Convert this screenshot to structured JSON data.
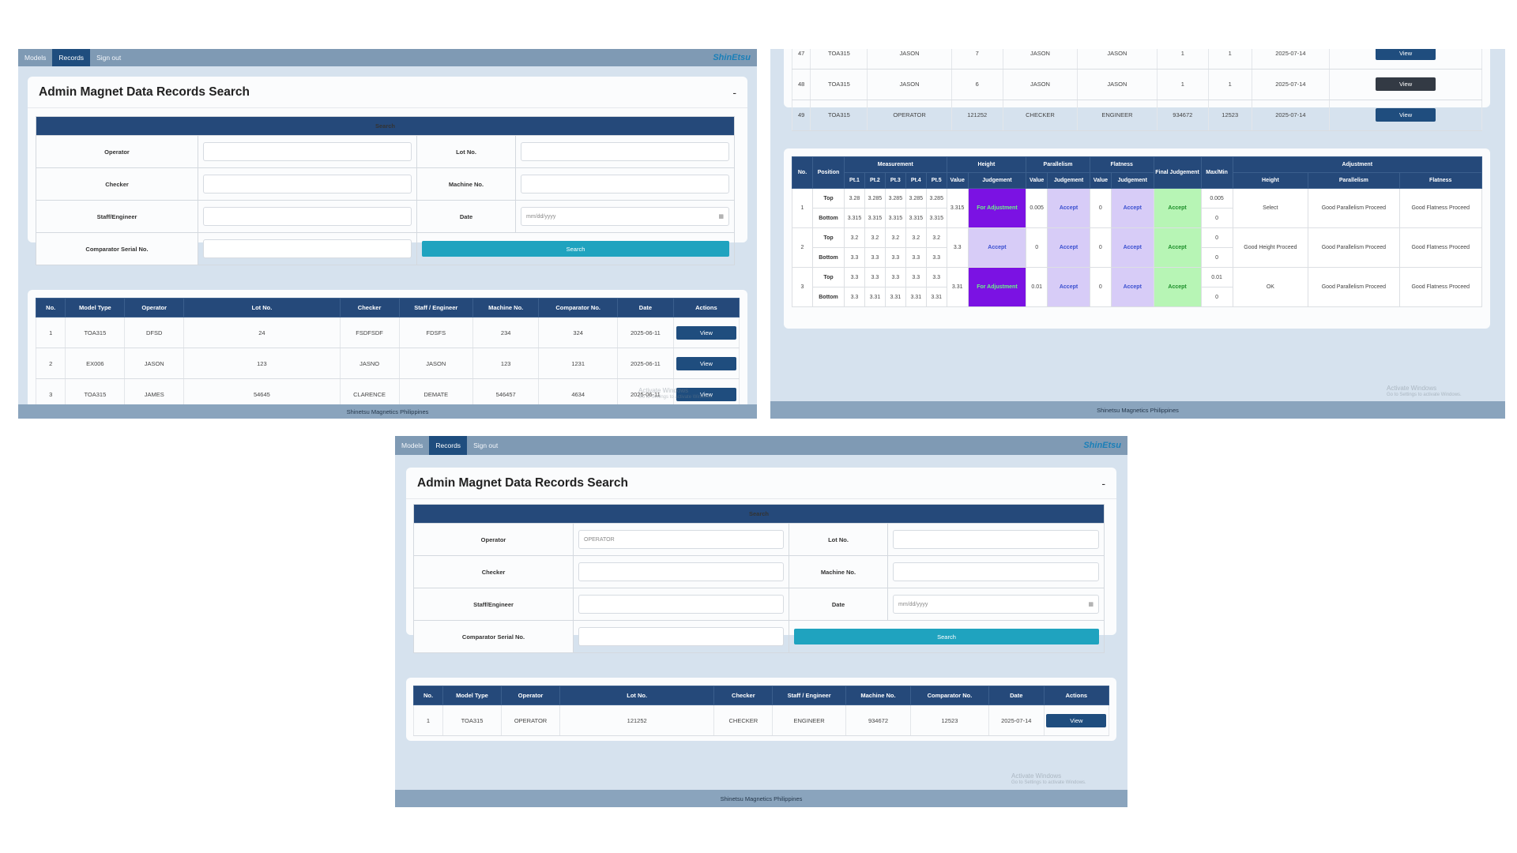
{
  "colors": {
    "nav_bg": "#7f9ab4",
    "nav_active": "#1f4d7e",
    "header_navy": "#25497a",
    "search_button": "#1fa3bf",
    "view_button": "#1f4d7e",
    "judgement_adjust": "#7b12e3",
    "judgement_accept": "#d7ccf7",
    "judgement_final_accept": "#b7f5b5"
  },
  "nav": {
    "models": "Models",
    "records": "Records",
    "signout": "Sign out",
    "brand": "ShinEtsu"
  },
  "footer": "Shinetsu Magnetics Philippines",
  "watermark": {
    "title": "Activate Windows",
    "subtitle": "Go to Settings to activate Windows."
  },
  "search_card": {
    "title": "Admin Magnet Data Records Search",
    "collapse": "-",
    "bar": "Search",
    "labels": {
      "operator": "Operator",
      "lot": "Lot No.",
      "checker": "Checker",
      "machine": "Machine No.",
      "staff": "Staff/Engineer",
      "date": "Date",
      "comparator": "Comparator Serial No."
    },
    "date_placeholder": "mm/dd/yyyy",
    "search_button": "Search"
  },
  "shot3_operator_value": "OPERATOR",
  "results_table": {
    "headers": [
      "No.",
      "Model Type",
      "Operator",
      "Lot No.",
      "Checker",
      "Staff / Engineer",
      "Machine No.",
      "Comparator No.",
      "Date",
      "Actions"
    ],
    "view": "View"
  },
  "shot1_rows": [
    [
      "1",
      "TOA315",
      "DFSD",
      "24",
      "FSDFSDF",
      "FDSFS",
      "234",
      "324",
      "2025-06-11"
    ],
    [
      "2",
      "EX006",
      "JASON",
      "123",
      "JASNO",
      "JASON",
      "123",
      "1231",
      "2025-06-11"
    ],
    [
      "3",
      "TOA315",
      "JAMES",
      "54645",
      "CLARENCE",
      "DEMATE",
      "546457",
      "4634",
      "2025-06-11"
    ]
  ],
  "shot2_rows": [
    [
      "47",
      "TOA315",
      "JASON",
      "7",
      "JASON",
      "JASON",
      "1",
      "1",
      "2025-07-14"
    ],
    [
      "48",
      "TOA315",
      "JASON",
      "6",
      "JASON",
      "JASON",
      "1",
      "1",
      "2025-07-14"
    ],
    [
      "49",
      "TOA315",
      "OPERATOR",
      "121252",
      "CHECKER",
      "ENGINEER",
      "934672",
      "12523",
      "2025-07-14"
    ]
  ],
  "shot3_rows": [
    [
      "1",
      "TOA315",
      "OPERATOR",
      "121252",
      "CHECKER",
      "ENGINEER",
      "934672",
      "12523",
      "2025-07-14"
    ]
  ],
  "measurement": {
    "group_headers": {
      "no": "No.",
      "position": "Position",
      "measurement": "Measurement",
      "height": "Height",
      "parallelism": "Parallelism",
      "flatness": "Flatness",
      "final": "Final Judgement",
      "maxmin": "Max/Min",
      "adjustment": "Adjustment"
    },
    "sub_headers": {
      "pt1": "Pt.1",
      "pt2": "Pt.2",
      "pt3": "Pt.3",
      "pt4": "Pt.4",
      "pt5": "Pt.5",
      "value": "Value",
      "judgement": "Judgement",
      "adj_height": "Height",
      "adj_parallelism": "Parallelism",
      "adj_flatness": "Flatness"
    },
    "rows": [
      {
        "no": "1",
        "top": {
          "label": "Top",
          "pts": [
            "3.28",
            "3.285",
            "3.285",
            "3.285",
            "3.285"
          ],
          "maxmin": "0.005"
        },
        "bottom": {
          "label": "Bottom",
          "pts": [
            "3.315",
            "3.315",
            "3.315",
            "3.315",
            "3.315"
          ],
          "maxmin": "0"
        },
        "height_value": "3.315",
        "height_judgement": "For Adjustment",
        "par_value": "0.005",
        "par_judgement": "Accept",
        "flat_value": "0",
        "flat_judgement": "Accept",
        "final": "Accept",
        "adj_height": "Select",
        "adj_par": "Good Parallelism Proceed",
        "adj_flat": "Good Flatness Proceed"
      },
      {
        "no": "2",
        "top": {
          "label": "Top",
          "pts": [
            "3.2",
            "3.2",
            "3.2",
            "3.2",
            "3.2"
          ],
          "maxmin": "0"
        },
        "bottom": {
          "label": "Bottom",
          "pts": [
            "3.3",
            "3.3",
            "3.3",
            "3.3",
            "3.3"
          ],
          "maxmin": "0"
        },
        "height_value": "3.3",
        "height_judgement": "Accept",
        "par_value": "0",
        "par_judgement": "Accept",
        "flat_value": "0",
        "flat_judgement": "Accept",
        "final": "Accept",
        "adj_height": "Good Height Proceed",
        "adj_par": "Good Parallelism Proceed",
        "adj_flat": "Good Flatness Proceed"
      },
      {
        "no": "3",
        "top": {
          "label": "Top",
          "pts": [
            "3.3",
            "3.3",
            "3.3",
            "3.3",
            "3.3"
          ],
          "maxmin": "0.01"
        },
        "bottom": {
          "label": "Bottom",
          "pts": [
            "3.3",
            "3.31",
            "3.31",
            "3.31",
            "3.31"
          ],
          "maxmin": "0"
        },
        "height_value": "3.31",
        "height_judgement": "For Adjustment",
        "par_value": "0.01",
        "par_judgement": "Accept",
        "flat_value": "0",
        "flat_judgement": "Accept",
        "final": "Accept",
        "adj_height": "OK",
        "adj_par": "Good Parallelism Proceed",
        "adj_flat": "Good Flatness Proceed"
      }
    ]
  }
}
